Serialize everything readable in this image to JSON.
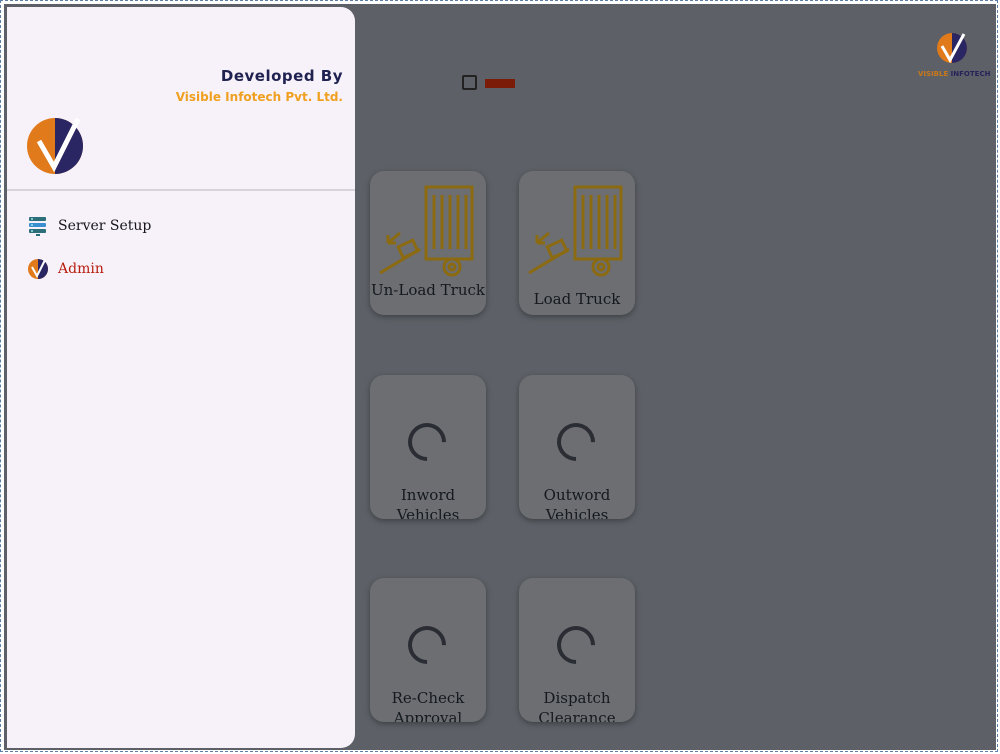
{
  "app": {
    "brand_logo": "visible-infotech-logo",
    "brand_text_highlight": "VISIBLE",
    "brand_text_rest": " INFOTECH"
  },
  "toolbar": {
    "checkbox_checked": false,
    "accent_color": "#7a1c08"
  },
  "tiles": [
    {
      "label": "Un-Load Truck",
      "icon": "unload-truck-icon"
    },
    {
      "label": "Load Truck",
      "icon": "load-truck-icon"
    },
    {
      "label": "Inword Vehicles",
      "icon": "loading-spinner-icon"
    },
    {
      "label": "Outword Vehicles",
      "icon": "loading-spinner-icon"
    },
    {
      "label": "Re-Check Approval",
      "icon": "loading-spinner-icon"
    },
    {
      "label": "Dispatch Clearance",
      "icon": "loading-spinner-icon"
    }
  ],
  "drawer": {
    "developed_by": "Developed By",
    "company": "Visible Infotech Pvt. Ltd.",
    "menu": [
      {
        "label": "Server Setup",
        "icon": "server-icon"
      },
      {
        "label": "Admin",
        "icon": "visible-infotech-logo"
      }
    ]
  },
  "colors": {
    "overlay_background": "#5d6167",
    "drawer_background": "#f7f2fa",
    "company_text": "#f0a020",
    "admin_text": "#b81e0e",
    "logo_orange": "#e07a1a",
    "logo_navy": "#2a2563",
    "truck_icon": "#8c6a10"
  }
}
